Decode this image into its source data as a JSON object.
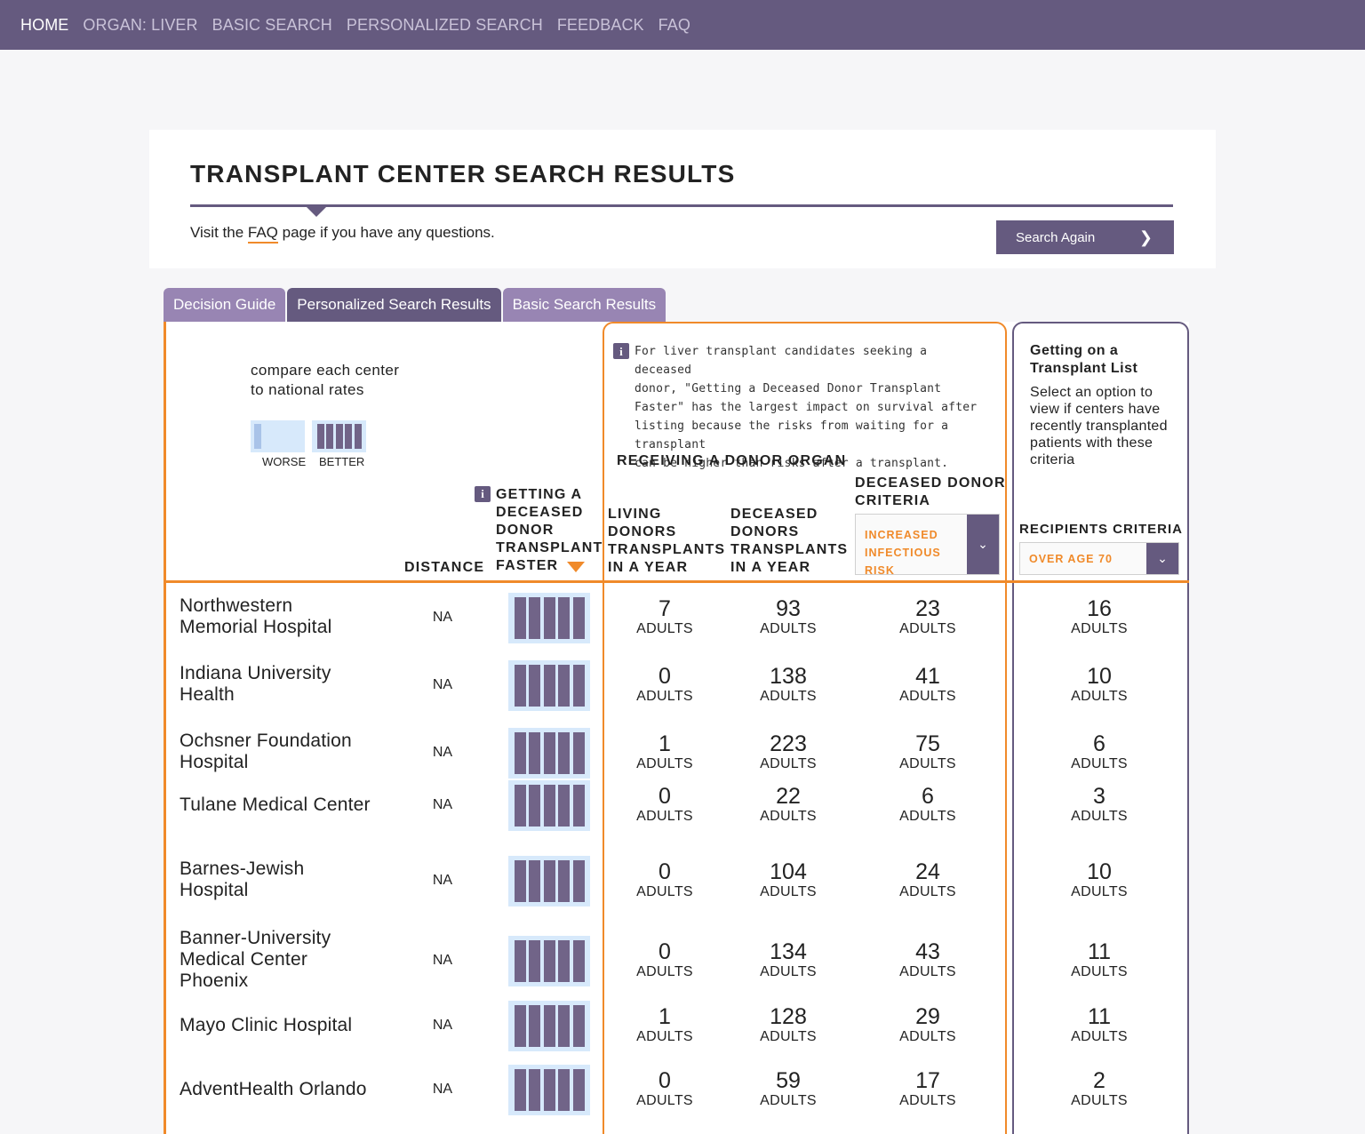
{
  "nav": {
    "items": [
      "HOME",
      "ORGAN: LIVER",
      "BASIC SEARCH",
      "PERSONALIZED SEARCH",
      "FEEDBACK",
      "FAQ"
    ]
  },
  "header": {
    "title": "TRANSPLANT CENTER SEARCH RESULTS",
    "faq_prefix": "Visit the ",
    "faq_link": "FAQ",
    "faq_suffix": " page if you have any questions.",
    "search_again": "Search Again"
  },
  "tabs": [
    "Decision Guide",
    "Personalized Search Results",
    "Basic Search Results"
  ],
  "legend": {
    "compare": "compare each center to national rates",
    "worse": "WORSE",
    "better": "BETTER"
  },
  "columns": {
    "distance": "DISTANCE",
    "faster": "GETTING A DECEASED DONOR TRANSPLANT FASTER",
    "receiving": "RECEIVING A DONOR ORGAN",
    "living": "LIVING DONORS TRANSPLANTS IN A YEAR",
    "deceased": "DECEASED DONORS TRANSPLANTS IN A YEAR",
    "criteria": "DECEASED DONOR CRITERIA",
    "criteria_value": "INCREASED INFECTIOUS RISK",
    "recipients": "RECIPIENTS CRITERIA",
    "recipients_value": "OVER AGE 70"
  },
  "note": {
    "lines": [
      "For liver transplant candidates seeking a deceased",
      "donor, \"Getting a Deceased Donor Transplant",
      "Faster\" has the largest impact on survival after",
      "listing because the risks from waiting for a transplant",
      "can be higher than risks after a transplant."
    ]
  },
  "list_box": {
    "title": "Getting on a Transplant List",
    "desc": "Select an option to view if centers have recently transplanted patients with these criteria"
  },
  "unit": "ADULTS",
  "rows": [
    {
      "name": "Northwestern Memorial Hospital",
      "distance": "NA",
      "faster_bars": 5,
      "living": "7",
      "deceased": "93",
      "criteria": "23",
      "recipients": "16"
    },
    {
      "name": "Indiana University Health",
      "distance": "NA",
      "faster_bars": 5,
      "living": "0",
      "deceased": "138",
      "criteria": "41",
      "recipients": "10"
    },
    {
      "name": "Ochsner Foundation Hospital",
      "distance": "NA",
      "faster_bars": 5,
      "living": "1",
      "deceased": "223",
      "criteria": "75",
      "recipients": "6"
    },
    {
      "name": "Tulane Medical Center",
      "distance": "NA",
      "faster_bars": 5,
      "living": "0",
      "deceased": "22",
      "criteria": "6",
      "recipients": "3"
    },
    {
      "name": "Barnes-Jewish Hospital",
      "distance": "NA",
      "faster_bars": 5,
      "living": "0",
      "deceased": "104",
      "criteria": "24",
      "recipients": "10"
    },
    {
      "name": "Banner-University Medical Center Phoenix",
      "distance": "NA",
      "faster_bars": 5,
      "living": "0",
      "deceased": "134",
      "criteria": "43",
      "recipients": "11"
    },
    {
      "name": "Mayo Clinic Hospital",
      "distance": "NA",
      "faster_bars": 5,
      "living": "1",
      "deceased": "128",
      "criteria": "29",
      "recipients": "11"
    },
    {
      "name": "AdventHealth Orlando",
      "distance": "NA",
      "faster_bars": 5,
      "living": "0",
      "deceased": "59",
      "criteria": "17",
      "recipients": "2"
    }
  ],
  "colors": {
    "nav": "#655a7f",
    "accent": "#f08a2a",
    "tab": "#9885b3",
    "bar": "#716488",
    "bar_bg": "#d7e9fb"
  }
}
